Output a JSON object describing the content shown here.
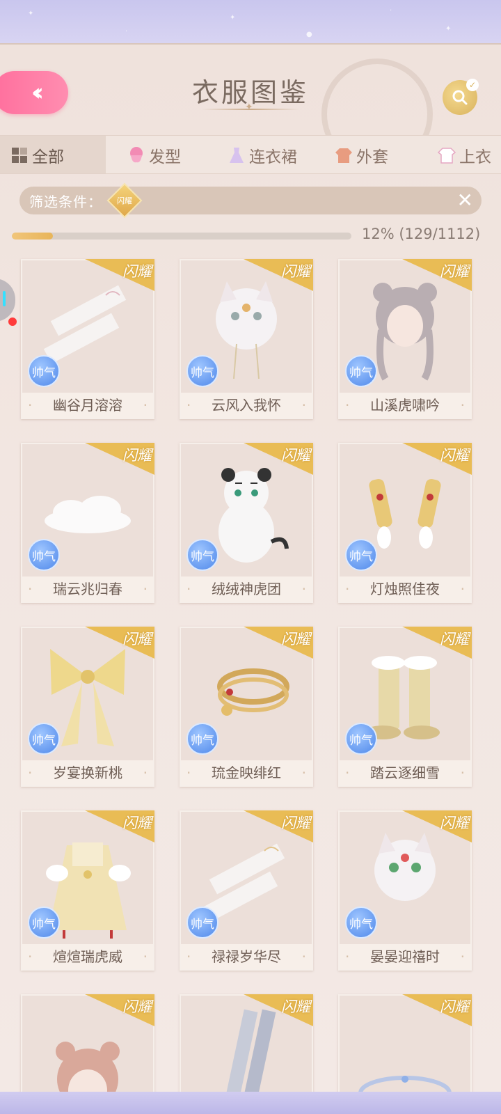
{
  "header": {
    "title": "衣服图鉴",
    "back_icon": "double-chevron-left-icon",
    "search_icon": "search-icon"
  },
  "tabs": [
    {
      "label": "全部",
      "icon": "grid-icon",
      "active": true
    },
    {
      "label": "发型",
      "icon": "hair-icon",
      "active": false
    },
    {
      "label": "连衣裙",
      "icon": "dress-icon",
      "active": false
    },
    {
      "label": "外套",
      "icon": "coat-icon",
      "active": false
    },
    {
      "label": "上衣",
      "icon": "shirt-icon",
      "active": false
    }
  ],
  "filter": {
    "label": "筛选条件：",
    "tag": "闪耀",
    "close_icon": "close-icon"
  },
  "progress": {
    "percent": 12,
    "text": "12% (129/1112)"
  },
  "items": [
    {
      "name": "幽谷月溶溶",
      "ribbon": "闪耀",
      "badge": "帅气"
    },
    {
      "name": "云风入我怀",
      "ribbon": "闪耀",
      "badge": "帅气"
    },
    {
      "name": "山溪虎啸吟",
      "ribbon": "闪耀",
      "badge": "帅气"
    },
    {
      "name": "瑞云兆归春",
      "ribbon": "闪耀",
      "badge": "帅气"
    },
    {
      "name": "绒绒神虎团",
      "ribbon": "闪耀",
      "badge": "帅气"
    },
    {
      "name": "灯烛照佳夜",
      "ribbon": "闪耀",
      "badge": "帅气"
    },
    {
      "name": "岁宴换新桃",
      "ribbon": "闪耀",
      "badge": "帅气"
    },
    {
      "name": "琉金映绯红",
      "ribbon": "闪耀",
      "badge": "帅气"
    },
    {
      "name": "踏云逐细雪",
      "ribbon": "闪耀",
      "badge": "帅气"
    },
    {
      "name": "煊煊瑞虎威",
      "ribbon": "闪耀",
      "badge": "帅气"
    },
    {
      "name": "禄禄岁华尽",
      "ribbon": "闪耀",
      "badge": "帅气"
    },
    {
      "name": "晏晏迎禧时",
      "ribbon": "闪耀",
      "badge": "帅气"
    },
    {
      "name": "",
      "ribbon": "闪耀",
      "badge": ""
    },
    {
      "name": "",
      "ribbon": "闪耀",
      "badge": ""
    },
    {
      "name": "",
      "ribbon": "闪耀",
      "badge": ""
    }
  ],
  "colors": {
    "accent_pink": "#ff7aa5",
    "gold": "#e9bc55",
    "badge_blue": "#4f88ea"
  }
}
